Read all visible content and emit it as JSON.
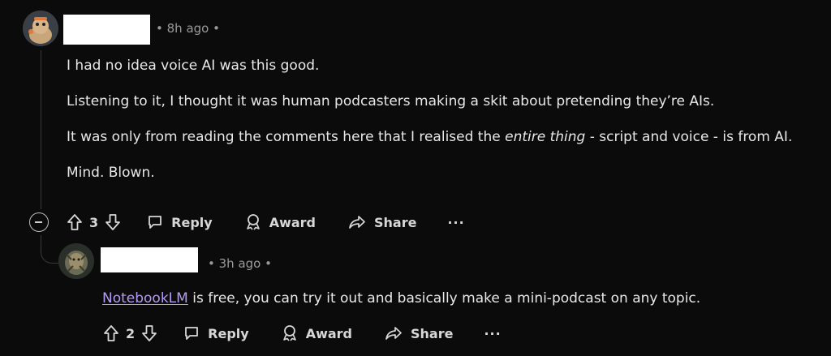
{
  "comment": {
    "time": "8h ago",
    "paragraph1": "I had no idea voice AI was this good.",
    "paragraph2": "Listening to it, I thought it was human podcasters making a skit about pretending they’re AIs.",
    "paragraph3_before": "It was only from reading the comments here that I realised the ",
    "paragraph3_italic": "entire thing",
    "paragraph3_after": " - script and voice - is from AI.",
    "paragraph4": "Mind. Blown.",
    "vote_count": "3",
    "reply_label": "Reply",
    "award_label": "Award",
    "share_label": "Share",
    "more_label": "···"
  },
  "reply": {
    "time": "3h ago",
    "link_text": "NotebookLM",
    "body_after_link": " is free, you can try it out and basically make a mini-podcast on any topic.",
    "vote_count": "2",
    "reply_label": "Reply",
    "award_label": "Award",
    "share_label": "Share",
    "more_label": "···"
  },
  "separator": "•"
}
